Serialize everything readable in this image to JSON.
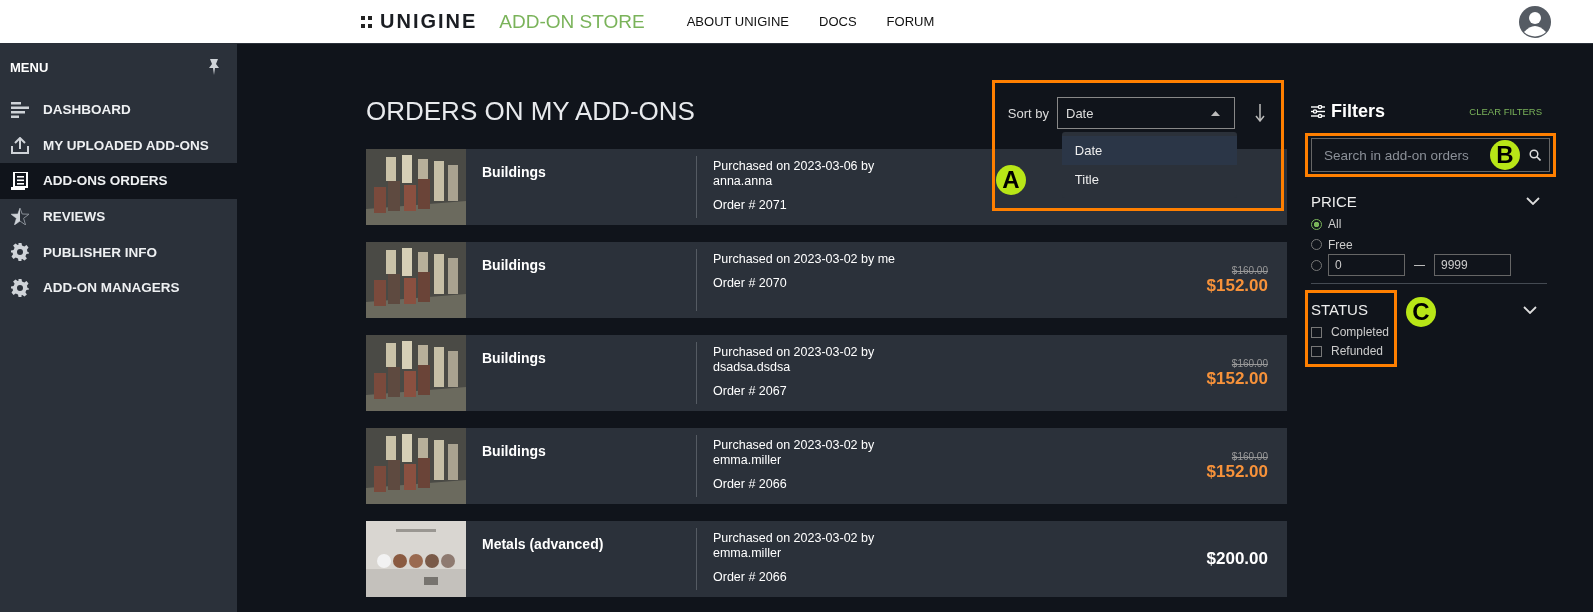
{
  "header": {
    "logo": "UNIGINE",
    "store_title": "ADD-ON STORE",
    "nav": [
      {
        "label": "ABOUT UNIGINE"
      },
      {
        "label": "DOCS"
      },
      {
        "label": "FORUM"
      }
    ]
  },
  "sidebar": {
    "title": "MENU",
    "items": [
      {
        "label": "DASHBOARD",
        "kind": "bars",
        "selected": false
      },
      {
        "label": "MY UPLOADED ADD-ONS",
        "kind": "upload",
        "selected": false
      },
      {
        "label": "ADD-ONS ORDERS",
        "kind": "list",
        "selected": true
      },
      {
        "label": "REVIEWS",
        "kind": "star",
        "selected": false
      },
      {
        "label": "PUBLISHER INFO",
        "kind": "gear",
        "selected": false
      },
      {
        "label": "ADD-ON MANAGERS",
        "kind": "gear",
        "selected": false
      }
    ]
  },
  "page_title": "ORDERS ON MY ADD-ONS",
  "sort": {
    "label": "Sort by",
    "value": "Date",
    "expanded": true,
    "callout": "A",
    "options": [
      {
        "label": "Date",
        "selected": true
      },
      {
        "label": "Title",
        "selected": false
      }
    ]
  },
  "orders": [
    {
      "title": "Buildings",
      "purchase": "Purchased on 2023-03-06 by anna.anna",
      "order": "Order # 2071"
    },
    {
      "title": "Buildings",
      "purchase": "Purchased on 2023-03-02 by me",
      "order": "Order # 2070",
      "old_price": "$160.00",
      "price": "$152.00"
    },
    {
      "title": "Buildings",
      "purchase": "Purchased on 2023-03-02 by dsadsa.dsdsa",
      "order": "Order # 2067",
      "old_price": "$160.00",
      "price": "$152.00"
    },
    {
      "title": "Buildings",
      "purchase": "Purchased on 2023-03-02 by emma.miller",
      "order": "Order # 2066",
      "old_price": "$160.00",
      "price": "$152.00"
    },
    {
      "title": "Metals (advanced)",
      "purchase": "Purchased on 2023-03-02 by emma.miller",
      "order": "Order # 2066",
      "price": "$200.00"
    }
  ],
  "filters": {
    "title": "Filters",
    "clear": "CLEAR FILTERS",
    "search": {
      "placeholder": "Search in add-on orders",
      "callout": "B"
    },
    "price": {
      "title": "PRICE",
      "expanded": true,
      "options": [
        {
          "kind": "option",
          "label": "All",
          "selected": true
        },
        {
          "kind": "option",
          "label": "Free",
          "selected": false
        },
        {
          "kind": "range",
          "min": "0",
          "max": "9999",
          "selected": false
        }
      ]
    },
    "status": {
      "title": "STATUS",
      "expanded": true,
      "callout": "C",
      "options": [
        {
          "label": "Completed",
          "checked": false
        },
        {
          "label": "Refunded",
          "checked": false
        }
      ]
    }
  }
}
